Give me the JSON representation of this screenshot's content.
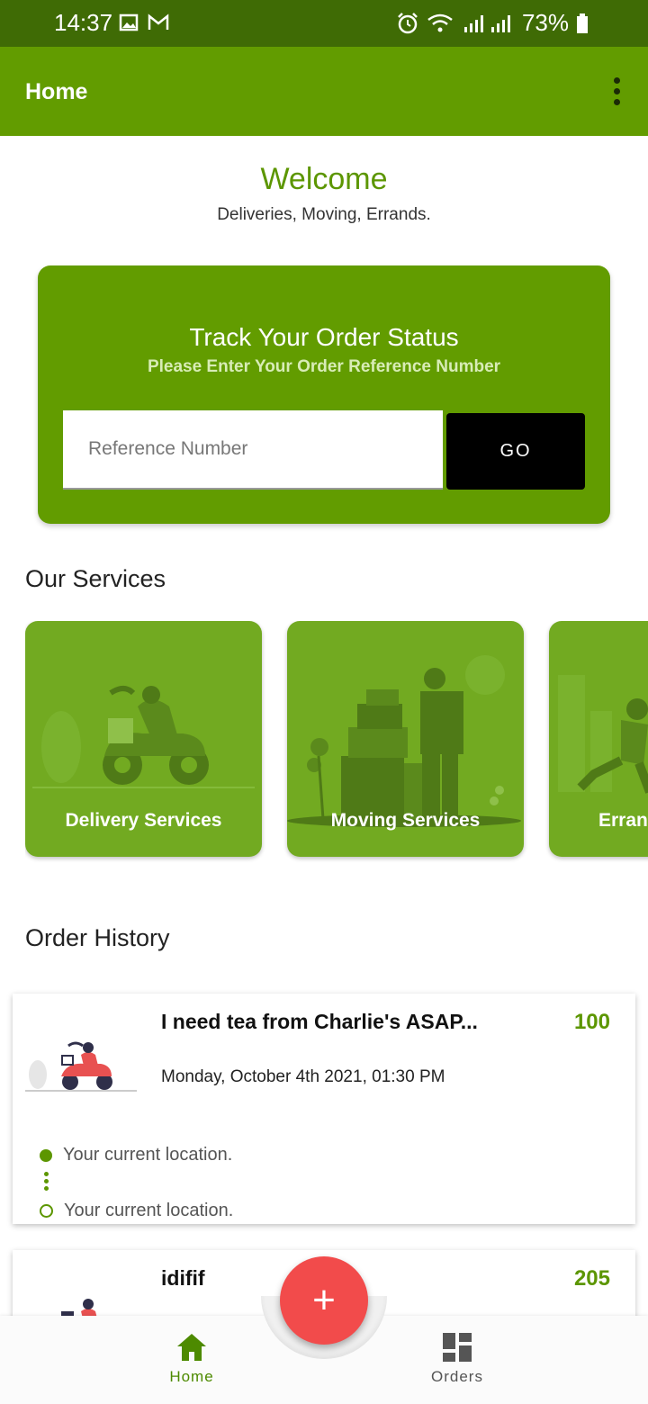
{
  "status_bar": {
    "time": "14:37",
    "battery": "73%"
  },
  "app_bar": {
    "title": "Home"
  },
  "welcome": {
    "title": "Welcome",
    "subtitle": "Deliveries, Moving, Errands."
  },
  "track": {
    "title": "Track Your Order Status",
    "subtitle": "Please Enter Your Order Reference Number",
    "input_placeholder": "Reference Number",
    "input_value": "",
    "go_label": "GO"
  },
  "services": {
    "heading": "Our Services",
    "items": [
      {
        "label": "Delivery Services"
      },
      {
        "label": "Moving Services"
      },
      {
        "label": "Erran"
      }
    ]
  },
  "order_history": {
    "heading": "Order History",
    "orders": [
      {
        "title": "I need tea from Charlie's ASAP...",
        "amount": "100",
        "date": "Monday, October 4th 2021, 01:30 PM",
        "pickup": "Your current location.",
        "dropoff": "Your current location."
      },
      {
        "title": "idifif",
        "amount": "205"
      }
    ]
  },
  "fab": {
    "label": "+"
  },
  "bottom_nav": {
    "home": "Home",
    "orders": "Orders"
  },
  "colors": {
    "primary": "#629c00",
    "status_bar": "#3f6b05",
    "accent": "#f24b4b",
    "amount": "#5c9600"
  },
  "icons": [
    "image-icon",
    "gmail-icon",
    "alarm-icon",
    "wifi-icon",
    "signal-icon",
    "battery-icon",
    "more-vert-icon",
    "home-icon",
    "dashboard-icon",
    "add-icon"
  ]
}
